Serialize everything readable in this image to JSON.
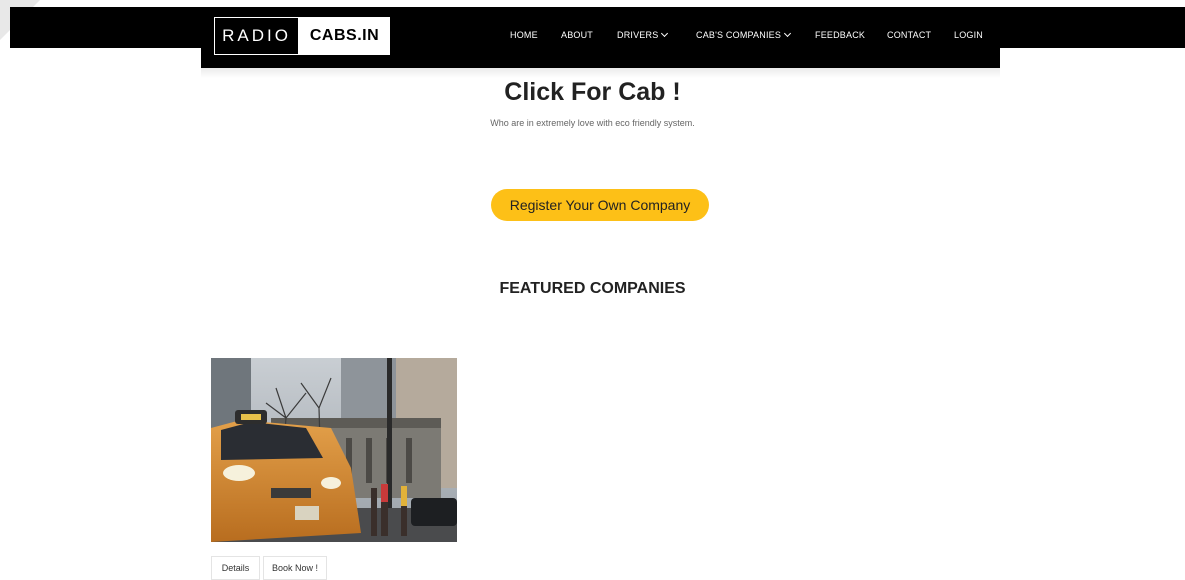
{
  "brand": {
    "logo_left": "RADIO",
    "logo_right": "CABS.IN"
  },
  "nav": {
    "items": [
      {
        "label": "HOME"
      },
      {
        "label": "ABOUT"
      },
      {
        "label": "DRIVERS"
      },
      {
        "label": "CAB'S COMPANIES"
      },
      {
        "label": "FEEDBACK"
      },
      {
        "label": "CONTACT"
      },
      {
        "label": "LOGIN"
      }
    ]
  },
  "hero": {
    "title": "Click For Cab !",
    "subtitle": "Who are in extremely love with eco friendly system.",
    "register_label": "Register Your Own Company"
  },
  "featured": {
    "title": "FEATURED COMPANIES",
    "card": {
      "details_label": "Details",
      "book_label": "Book Now !"
    }
  },
  "colors": {
    "navbar": "#000000",
    "accent": "#fdc017",
    "taxi": "#d98a2b"
  }
}
